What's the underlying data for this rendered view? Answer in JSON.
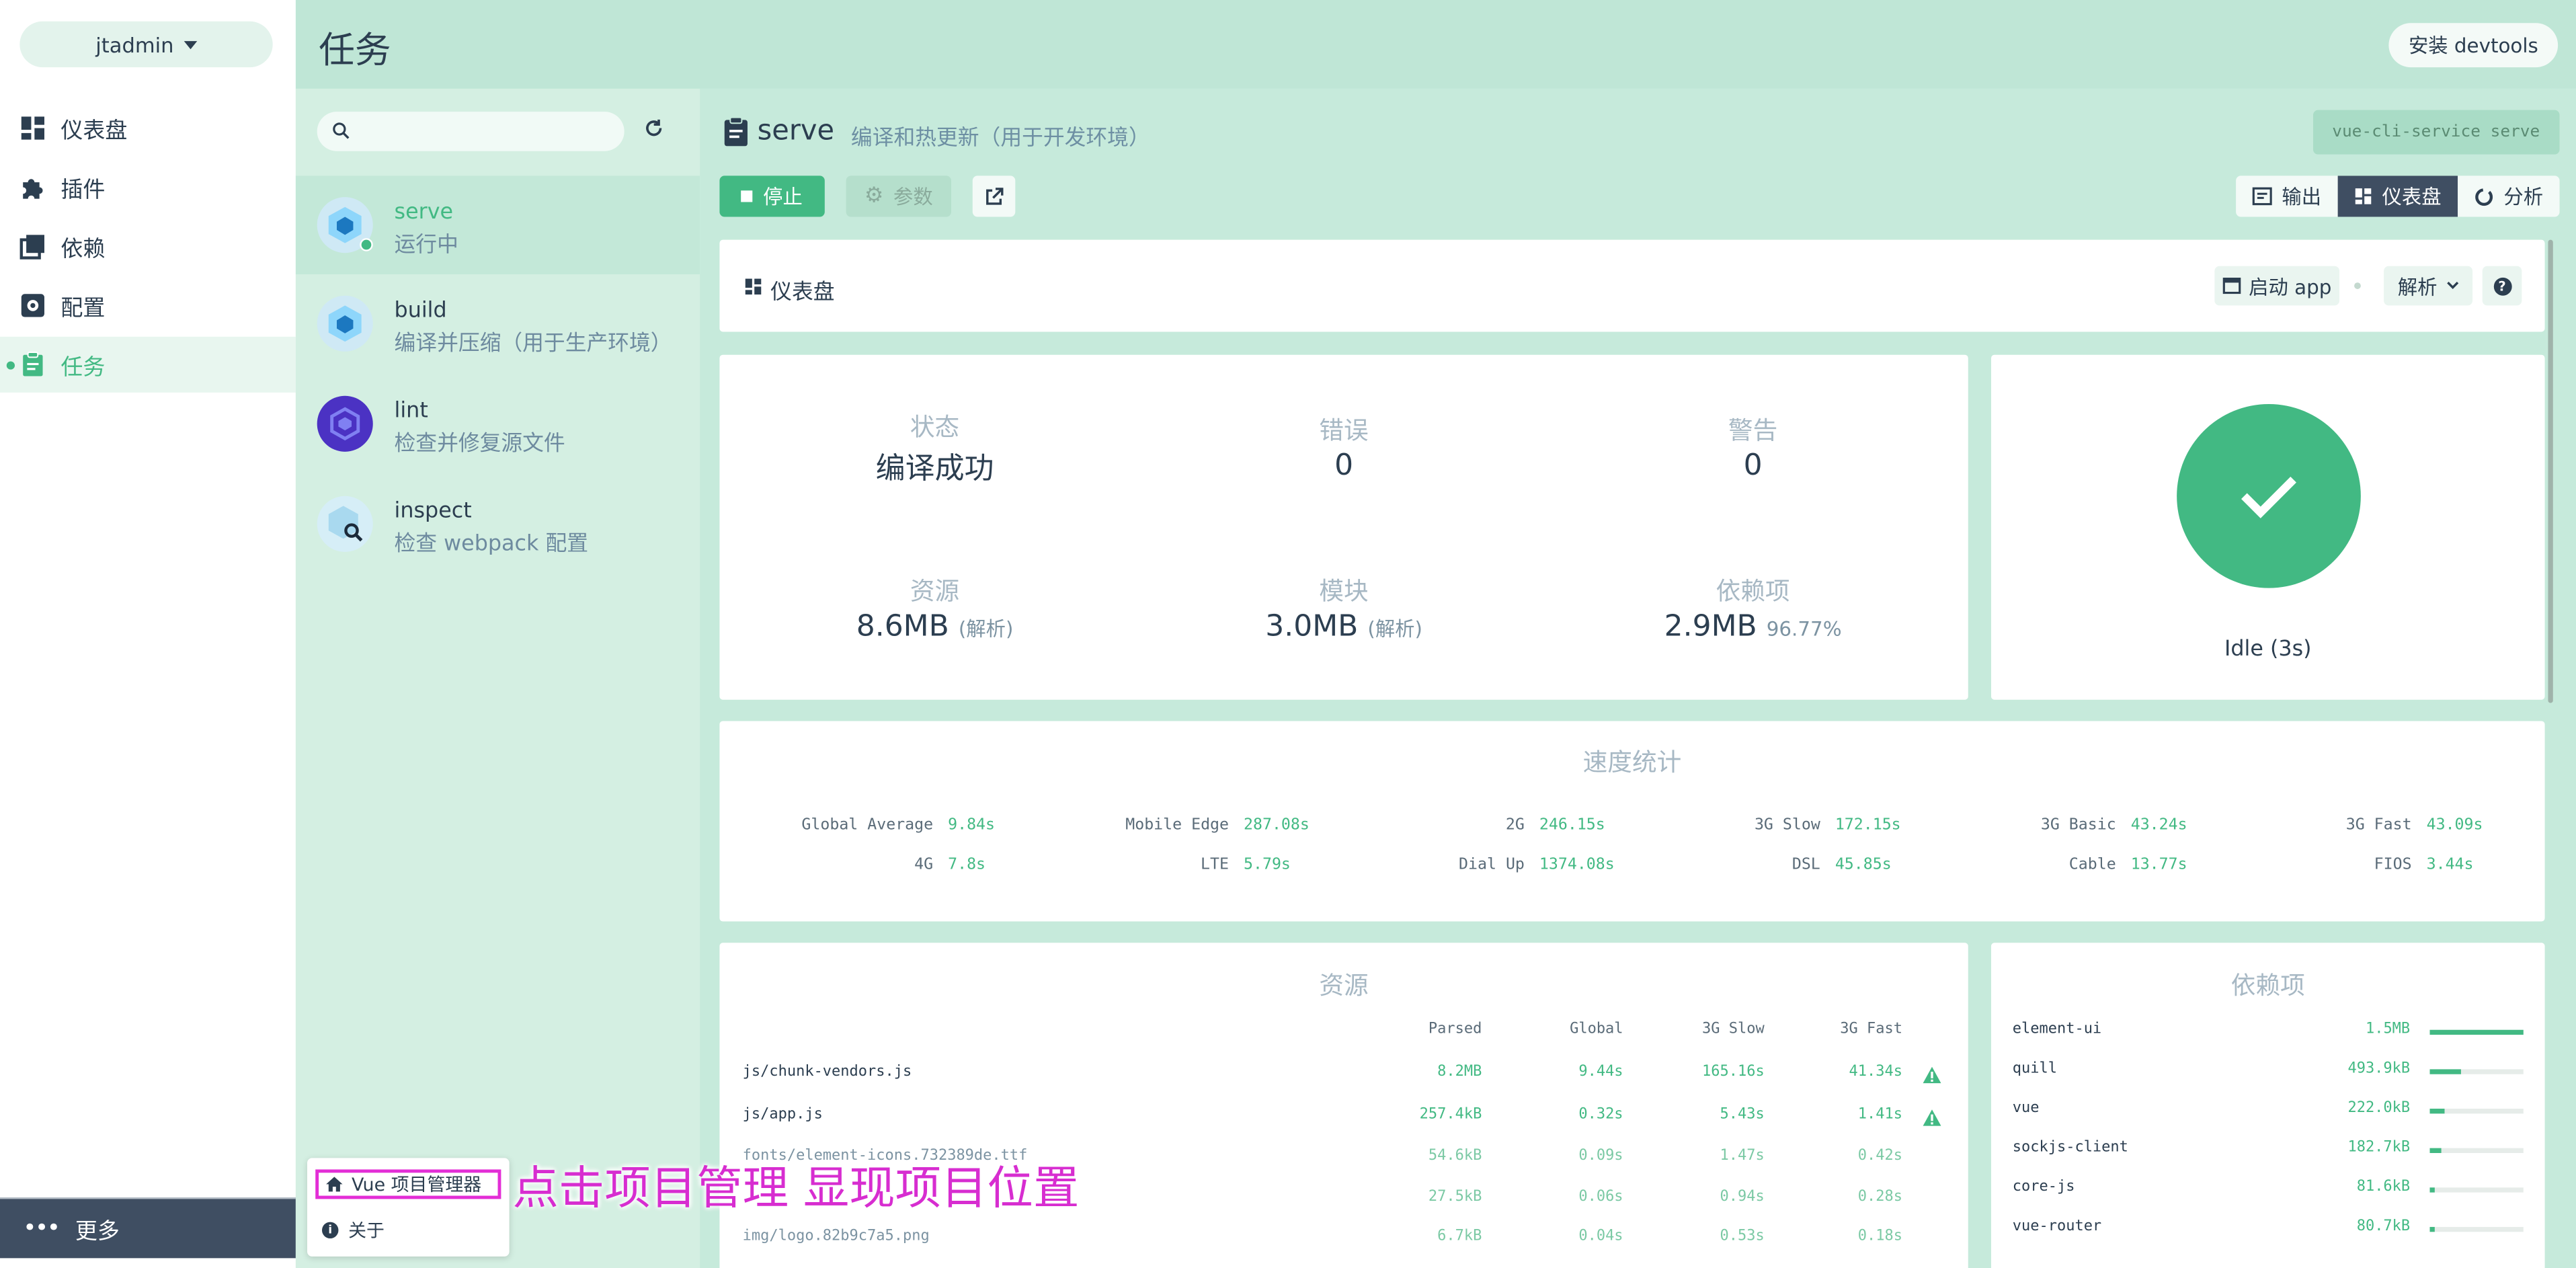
{
  "nav": {
    "user": "jtadmin",
    "items": [
      {
        "label": "仪表盘",
        "icon": "dashboard-icon"
      },
      {
        "label": "插件",
        "icon": "puzzle-icon"
      },
      {
        "label": "依赖",
        "icon": "library-icon"
      },
      {
        "label": "配置",
        "icon": "settings-icon"
      },
      {
        "label": "任务",
        "icon": "task-icon"
      }
    ],
    "more": "更多"
  },
  "header": {
    "title": "任务",
    "devtools": "安装 devtools"
  },
  "tasks": [
    {
      "name": "serve",
      "desc": "运行中"
    },
    {
      "name": "build",
      "desc": "编译并压缩（用于生产环境）"
    },
    {
      "name": "lint",
      "desc": "检查并修复源文件"
    },
    {
      "name": "inspect",
      "desc": "检查 webpack 配置"
    }
  ],
  "main": {
    "title": "serve",
    "subtitle": "编译和热更新（用于开发环境）",
    "command": "vue-cli-service serve",
    "stop": "停止",
    "params": "参数",
    "views": {
      "output": "输出",
      "dashboard": "仪表盘",
      "analyze": "分析"
    }
  },
  "dashboard": {
    "title": "仪表盘",
    "start_app": "启动 app",
    "analyze": "解析",
    "stats": {
      "status_label": "状态",
      "status_value": "编译成功",
      "errors_label": "错误",
      "errors_value": "0",
      "warnings_label": "警告",
      "warnings_value": "0",
      "assets_label": "资源",
      "assets_value": "8.6MB",
      "assets_note": "(解析)",
      "modules_label": "模块",
      "modules_value": "3.0MB",
      "modules_note": "(解析)",
      "deps_label": "依赖项",
      "deps_value": "2.9MB",
      "deps_note": "96.77%"
    },
    "idle": "Idle (3s)"
  },
  "speed": {
    "title": "速度统计",
    "rows": [
      [
        {
          "label": "Global Average",
          "value": "9.84s"
        },
        {
          "label": "Mobile Edge",
          "value": "287.08s"
        },
        {
          "label": "2G",
          "value": "246.15s"
        },
        {
          "label": "3G Slow",
          "value": "172.15s"
        },
        {
          "label": "3G Basic",
          "value": "43.24s"
        },
        {
          "label": "3G Fast",
          "value": "43.09s"
        }
      ],
      [
        {
          "label": "4G",
          "value": "7.8s"
        },
        {
          "label": "LTE",
          "value": "5.79s"
        },
        {
          "label": "Dial Up",
          "value": "1374.08s"
        },
        {
          "label": "DSL",
          "value": "45.85s"
        },
        {
          "label": "Cable",
          "value": "13.77s"
        },
        {
          "label": "FIOS",
          "value": "3.44s"
        }
      ]
    ]
  },
  "assets": {
    "title": "资源",
    "headers": [
      "Parsed",
      "Global",
      "3G Slow",
      "3G Fast"
    ],
    "rows": [
      {
        "file": "js/chunk-vendors.js",
        "parsed": "8.2MB",
        "global": "9.44s",
        "slow": "165.16s",
        "fast": "41.34s"
      },
      {
        "file": "js/app.js",
        "parsed": "257.4kB",
        "global": "0.32s",
        "slow": "5.43s",
        "fast": "1.41s"
      },
      {
        "file": "fonts/element-icons.732389de.ttf",
        "parsed": "54.6kB",
        "global": "0.09s",
        "slow": "1.47s",
        "fast": "0.42s"
      },
      {
        "file": "",
        "parsed": "27.5kB",
        "global": "0.06s",
        "slow": "0.94s",
        "fast": "0.28s"
      },
      {
        "file": "img/logo.82b9c7a5.png",
        "parsed": "6.7kB",
        "global": "0.04s",
        "slow": "0.53s",
        "fast": "0.18s"
      }
    ]
  },
  "deps": {
    "title": "依赖项",
    "rows": [
      {
        "name": "element-ui",
        "size": "1.5MB",
        "ratio": 1.0
      },
      {
        "name": "quill",
        "size": "493.9kB",
        "ratio": 0.33
      },
      {
        "name": "vue",
        "size": "222.0kB",
        "ratio": 0.15
      },
      {
        "name": "sockjs-client",
        "size": "182.7kB",
        "ratio": 0.12
      },
      {
        "name": "core-js",
        "size": "81.6kB",
        "ratio": 0.055
      },
      {
        "name": "vue-router",
        "size": "80.7kB",
        "ratio": 0.054
      }
    ]
  },
  "menu": {
    "vue_manager": "Vue 项目管理器",
    "about": "关于"
  },
  "annotation": "点击项目管理 显现项目位置",
  "colors": {
    "accent": "#42b983",
    "dark": "#3f4e62",
    "annotation": "#e32ed6"
  }
}
